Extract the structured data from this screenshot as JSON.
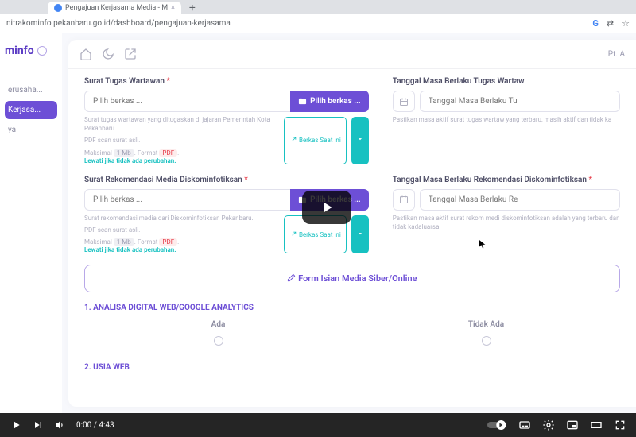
{
  "browser": {
    "tab_active": "Pengajuan Kerjasama Media - M",
    "tab_new": "+",
    "url": "nitrakominfo.pekanbaru.go.id/dashboard/pengajuan-kerjasama"
  },
  "brand": "minfo",
  "nav": {
    "item0": "erusaha...",
    "item1": "Kerjasa...",
    "item2": "ya"
  },
  "topbar": {
    "company": "Pt. A"
  },
  "form": {
    "stw": {
      "label": "Surat Tugas Wartawan",
      "placeholder": "Pilih berkas ...",
      "btn": "Pilih berkas ...",
      "help1": "Surat tugas wartawan yang ditugaskan di jajaran Pemerintah Kota Pekanbaru.",
      "help2": "PDF scan surat asli.",
      "maksimal": "Maksimal",
      "mb": "1 Mb",
      "format": "Format",
      "pdf": "PDF",
      "skip": "Lewati jika tidak ada perubahan.",
      "berkas_now": "Berkas Saat ini"
    },
    "stw_date": {
      "label": "Tanggal Masa Berlaku Tugas Wartaw",
      "placeholder": "Tanggal Masa Berlaku Tu",
      "help": "Pastikan masa aktif surat tugas wartaw yang terbaru, masih aktif dan tidak ka"
    },
    "srmd": {
      "label": "Surat Rekomendasi Media Diskominfotiksan",
      "placeholder": "Pilih berkas ...",
      "btn": "Pilih berkas ...",
      "help1": "Surat rekomendasi media dari Diskominfotiksan Pekanbaru.",
      "help2": "PDF scan surat asli.",
      "maksimal": "Maksimal",
      "mb": "1 Mb",
      "format": "Format",
      "pdf": "PDF",
      "skip": "Lewati jika tidak ada perubahan.",
      "berkas_now": "Berkas Saat ini"
    },
    "srmd_date": {
      "label": "Tanggal Masa Berlaku Rekomendasi Diskominfotiksan",
      "placeholder": "Tanggal Masa Berlaku Re",
      "help": "Pastikan masa aktif surat rekom medi diskominfotiksan adalah yang terbaru dan tidak kadaluarsa."
    },
    "banner": "Form Isian Media Siber/Online",
    "section1": "1. ANALISA DIGITAL WEB/GOOGLE ANALYTICS",
    "ada": "Ada",
    "tidak": "Tidak Ada",
    "section2": "2. USIA WEB"
  },
  "video": {
    "current": "0:00",
    "duration": "4:43"
  }
}
